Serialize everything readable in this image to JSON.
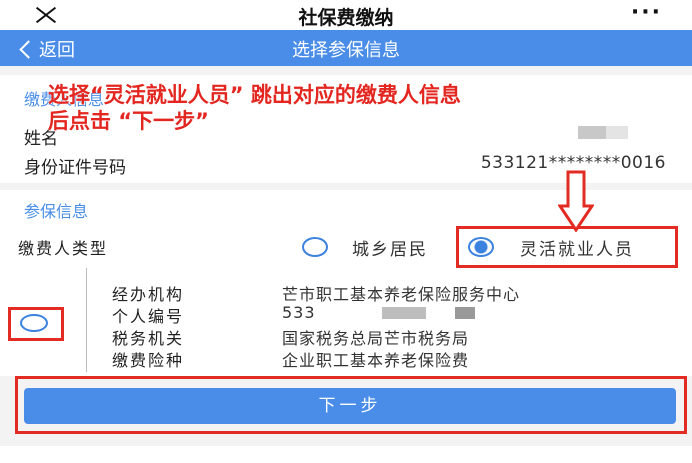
{
  "app": {
    "title": "社保费缴纳"
  },
  "nav": {
    "back_label": "返回",
    "title": "选择参保信息"
  },
  "payer_info": {
    "section_title": "缴费人信息",
    "name_label": "姓名",
    "id_label": "身份证件号码",
    "id_value": "533121********0016"
  },
  "annotation": {
    "line1": "选择“灵活就业人员” 跳出对应的缴费人信息",
    "line2": "后点击 “下一步”"
  },
  "insurance": {
    "section_title": "参保信息",
    "payer_type_label": "缴费人类型",
    "options": [
      {
        "label": "城乡居民",
        "selected": false
      },
      {
        "label": "灵活就业人员",
        "selected": true
      }
    ],
    "details": [
      {
        "label": "经办机构",
        "value": "芒市职工基本养老保险服务中心"
      },
      {
        "label": "个人编号",
        "value": "533"
      },
      {
        "label": "税务机关",
        "value": "国家税务总局芒市税务局"
      },
      {
        "label": "缴费险种",
        "value": "企业职工基本养老保险费"
      }
    ],
    "record_selected": false
  },
  "next_button": {
    "label": "下一步"
  },
  "colors": {
    "accent": "#4a8de8",
    "annotation": "#e3261f"
  },
  "icons": [
    "close-icon",
    "more-icon",
    "back-chevron-icon",
    "arrow-down-icon"
  ]
}
